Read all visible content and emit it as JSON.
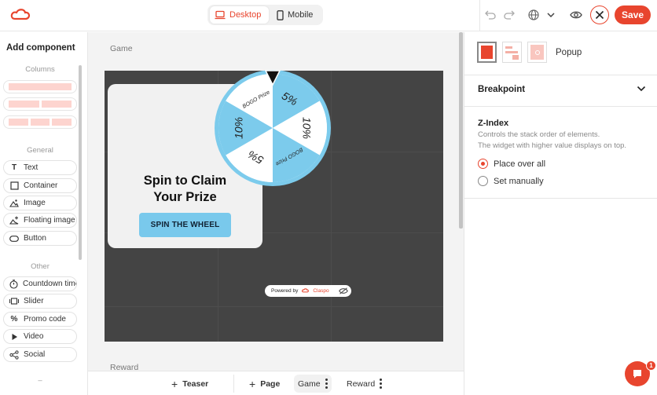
{
  "topbar": {
    "device_desktop": "Desktop",
    "device_mobile": "Mobile",
    "save_label": "Save",
    "accent": "#e8452e"
  },
  "left_panel": {
    "title": "Add component",
    "sections": {
      "columns": "Columns",
      "general": "General",
      "other": "Other"
    },
    "general_items": [
      {
        "label": "Text",
        "icon": "text-icon"
      },
      {
        "label": "Container",
        "icon": "container-icon"
      },
      {
        "label": "Image",
        "icon": "image-icon"
      },
      {
        "label": "Floating image",
        "icon": "floating-image-icon"
      },
      {
        "label": "Button",
        "icon": "button-icon"
      }
    ],
    "other_items": [
      {
        "label": "Countdown timer",
        "icon": "timer-icon"
      },
      {
        "label": "Slider",
        "icon": "slider-icon"
      },
      {
        "label": "Promo code",
        "icon": "percent-icon"
      },
      {
        "label": "Video",
        "icon": "play-icon"
      },
      {
        "label": "Social",
        "icon": "share-icon"
      }
    ],
    "more_label": "–"
  },
  "canvas": {
    "label": "Game",
    "next_label": "Reward",
    "popup": {
      "title_line1": "Spin to Claim",
      "title_line2": "Your Prize",
      "button": "SPIN THE WHEEL"
    },
    "wheel_segments": [
      "5%",
      "10%",
      "BOGO Prize",
      "5%",
      "10%",
      "BOGO Prize"
    ],
    "wheel_colors": {
      "blue": "#7ccbec",
      "white": "#ffffff"
    },
    "powered_by": "Powered by",
    "brand": "Claspo"
  },
  "bottom_bar": {
    "teaser": "Teaser",
    "page": "Page",
    "game": "Game",
    "reward": "Reward"
  },
  "right_panel": {
    "popup_label": "Popup",
    "breakpoint": "Breakpoint",
    "zindex_title": "Z-Index",
    "zindex_desc1": "Controls the stack order of elements.",
    "zindex_desc2": "The widget with higher value displays on top.",
    "option_over_all": "Place over all",
    "option_manual": "Set manually"
  },
  "chat": {
    "badge": "1"
  }
}
